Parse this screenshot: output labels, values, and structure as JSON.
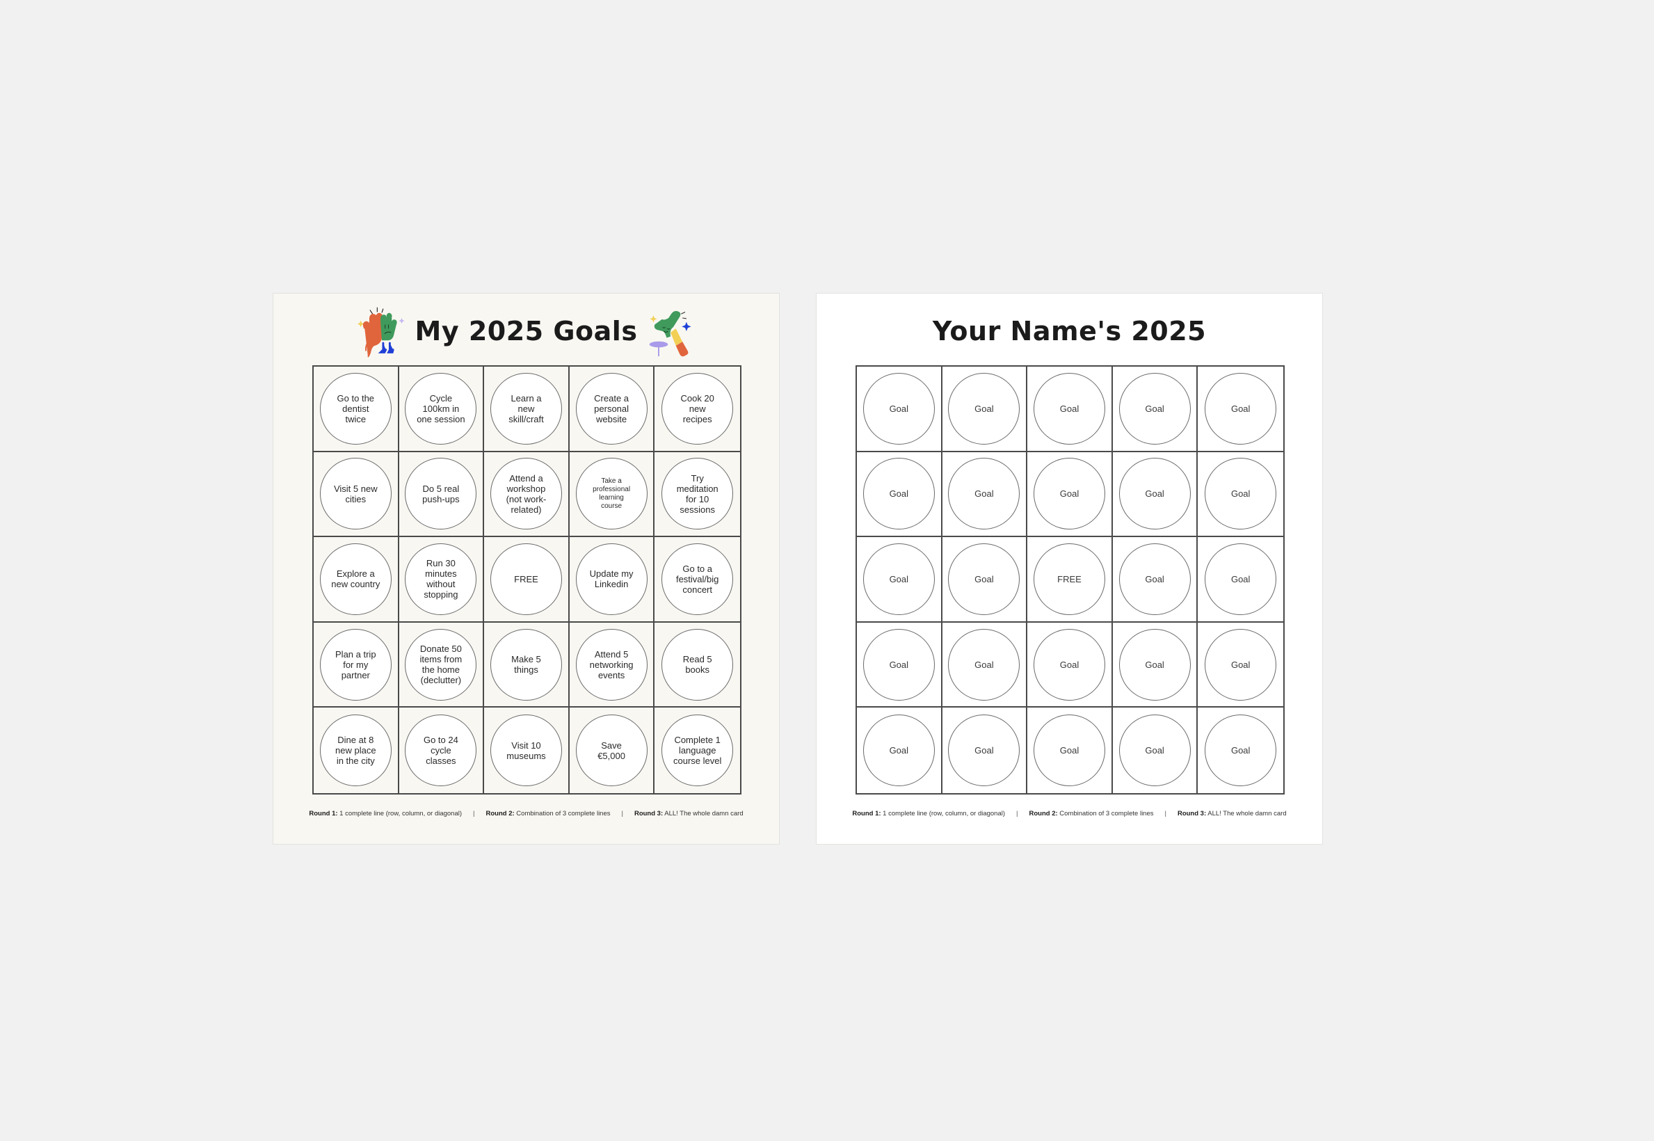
{
  "cards": [
    {
      "title": "My 2025 Goals",
      "illustrations": [
        "high-five-hands-icon",
        "hammer-nail-icon"
      ],
      "cells": [
        [
          "Go to the\ndentist\ntwice",
          "Cycle\n100km in\none session",
          "Learn a\nnew\nskill/craft",
          "Create a\npersonal\nwebsite",
          "Cook 20\nnew\nrecipes"
        ],
        [
          "Visit 5 new\ncities",
          "Do 5 real\npush-ups",
          "Attend a\nworkshop\n(not work-\nrelated)",
          "Take a\nprofessional\nlearning\ncourse",
          "Try\nmeditation\nfor 10\nsessions"
        ],
        [
          "Explore a\nnew country",
          "Run 30\nminutes\nwithout\nstopping",
          "FREE",
          "Update my\nLinkedin",
          "Go to a\nfestival/big\nconcert"
        ],
        [
          "Plan a trip\nfor my\npartner",
          "Donate 50\nitems from\nthe home\n(declutter)",
          "Make 5\nthings",
          "Attend 5\nnetworking\nevents",
          "Read 5\nbooks"
        ],
        [
          "Dine at 8\nnew place\nin the city",
          "Go to 24\ncycle\nclasses",
          "Visit 10\nmuseums",
          "Save\n€5,000",
          "Complete 1\nlanguage\ncourse level"
        ]
      ],
      "footer": [
        {
          "label": "Round 1:",
          "text": " 1 complete line (row, column, or diagonal)"
        },
        {
          "label": "Round 2:",
          "text": " Combination of 3 complete lines"
        },
        {
          "label": "Round 3:",
          "text": " ALL! The whole damn card"
        }
      ],
      "separator": "|",
      "background": "#f9f7f2"
    },
    {
      "title": "Your Name's 2025",
      "cells": [
        [
          "Goal",
          "Goal",
          "Goal",
          "Goal",
          "Goal"
        ],
        [
          "Goal",
          "Goal",
          "Goal",
          "Goal",
          "Goal"
        ],
        [
          "Goal",
          "Goal",
          "FREE",
          "Goal",
          "Goal"
        ],
        [
          "Goal",
          "Goal",
          "Goal",
          "Goal",
          "Goal"
        ],
        [
          "Goal",
          "Goal",
          "Goal",
          "Goal",
          "Goal"
        ]
      ],
      "footer": [
        {
          "label": "Round 1:",
          "text": " 1 complete line (row, column, or diagonal)"
        },
        {
          "label": "Round 2:",
          "text": " Combination of 3 complete lines"
        },
        {
          "label": "Round 3:",
          "text": " ALL! The whole damn card"
        }
      ],
      "separator": "|",
      "background": "#ffffff"
    }
  ],
  "colors": {
    "page_background": "#f1f1f1",
    "grid_line": "#4a4a4a",
    "hand_orange": "#e0653c",
    "hand_green": "#3f9a5c",
    "feet_blue": "#1f3fd6",
    "hammer_yellow": "#f2d056",
    "nail_purple": "#a99bea"
  }
}
